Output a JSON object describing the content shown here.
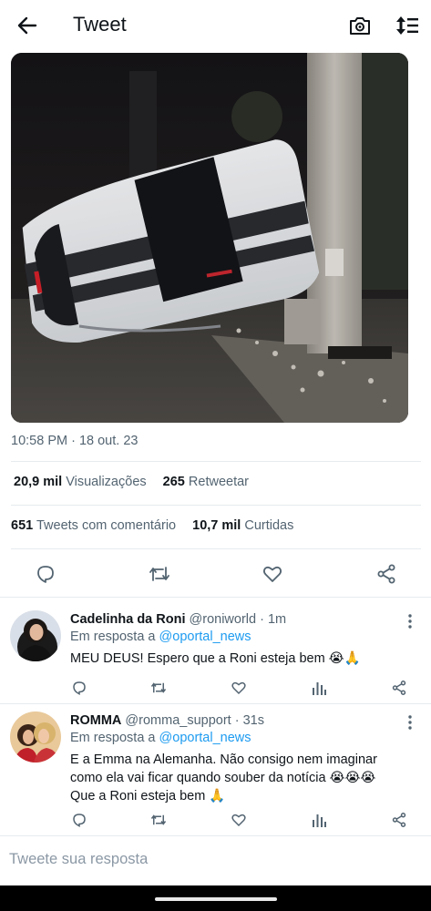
{
  "header": {
    "title": "Tweet",
    "back_icon": "arrow-left-icon",
    "camera_icon": "camera-icon",
    "sort_icon": "sort-icon"
  },
  "tweet": {
    "timestamp": "10:58 PM · 18 out. 23",
    "views_count": "20,9 mil",
    "views_label": "Visualizações",
    "retweets_count": "265",
    "retweets_label": "Retweetar",
    "quotes_count": "651",
    "quotes_label": "Tweets com comentário",
    "likes_count": "10,7 mil",
    "likes_label": "Curtidas"
  },
  "replies": [
    {
      "name": "Cadelinha da Roni",
      "handle": "@roniworld",
      "time": "1m",
      "reply_prefix": "Em resposta a",
      "reply_to": "@oportal_news",
      "lines": [
        "MEU DEUS! Espero que a Roni esteja bem 😭🙏"
      ]
    },
    {
      "name": "ROMMA",
      "handle": "@romma_support",
      "time": "31s",
      "reply_prefix": "Em resposta a",
      "reply_to": "@oportal_news",
      "lines": [
        "E a Emma na Alemanha. Não consigo nem imaginar",
        "como ela vai ficar quando souber da notícia 😭😭😭",
        "Que a Roni esteja bem 🙏"
      ]
    }
  ],
  "compose": {
    "placeholder": "Tweete sua resposta"
  },
  "colors": {
    "accent": "#1d9bf0",
    "text": "#0f1419",
    "muted": "#536471",
    "divider": "#e6ebee"
  }
}
